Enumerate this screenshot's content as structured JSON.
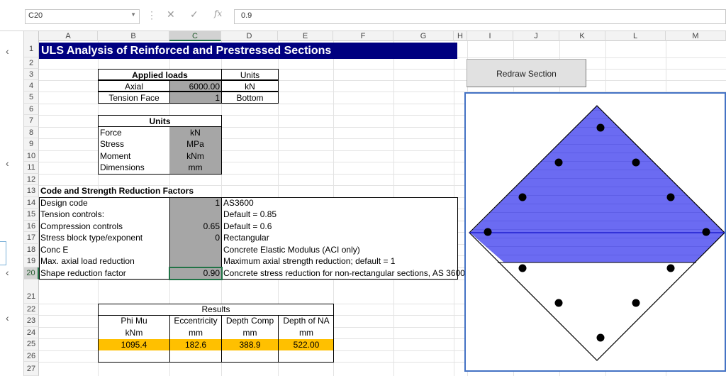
{
  "formula_bar": {
    "name_box": "C20",
    "formula_value": "0.9",
    "fx_label": "fx",
    "cancel_glyph": "✕",
    "enter_glyph": "✓"
  },
  "columns": [
    "A",
    "B",
    "C",
    "D",
    "E",
    "F",
    "G",
    "H",
    "I",
    "J",
    "K",
    "L",
    "M"
  ],
  "rows": [
    "1",
    "2",
    "3",
    "4",
    "5",
    "6",
    "7",
    "8",
    "9",
    "10",
    "11",
    "12",
    "13",
    "14",
    "15",
    "16",
    "17",
    "18",
    "19",
    "20",
    "21",
    "22",
    "23",
    "24",
    "25",
    "26",
    "27"
  ],
  "title": "ULS Analysis of Reinforced and Prestressed Sections",
  "applied_loads": {
    "header": "Applied loads",
    "units_header": "Units",
    "axial_label": "Axial",
    "axial_value": "6000.00",
    "axial_unit": "kN",
    "tension_label": "Tension Face",
    "tension_value": "1",
    "tension_unit": "Bottom"
  },
  "units_table": {
    "header": "Units",
    "rows": [
      {
        "label": "Force",
        "value": "kN"
      },
      {
        "label": "Stress",
        "value": "MPa"
      },
      {
        "label": "Moment",
        "value": "kNm"
      },
      {
        "label": "Dimensions",
        "value": "mm"
      }
    ]
  },
  "code_factors": {
    "header": "Code and Strength Reduction Factors",
    "rows": [
      {
        "label": "Design code",
        "value": "1",
        "note": "AS3600"
      },
      {
        "label": "Tension controls:",
        "value": "",
        "note": "Default = 0.85"
      },
      {
        "label": "Compression controls",
        "value": "0.65",
        "note": "Default = 0.6"
      },
      {
        "label": "Stress block type/exponent",
        "value": "0",
        "note": "Rectangular"
      },
      {
        "label": "Conc E",
        "value": "",
        "note": "Concrete Elastic Modulus (ACI only)"
      },
      {
        "label": "Max. axial load reduction",
        "value": "",
        "note": "Maximum axial strength reduction; default = 1"
      },
      {
        "label": "Shape reduction factor",
        "value": "0.90",
        "note": "Concrete stress reduction for non-rectangular sections, AS 3600"
      }
    ]
  },
  "results": {
    "header": "Results",
    "columns": [
      {
        "name": "Phi Mu",
        "unit": "kNm",
        "value": "1095.4"
      },
      {
        "name": "Eccentricity",
        "unit": "mm",
        "value": "182.6"
      },
      {
        "name": "Depth Comp",
        "unit": "mm",
        "value": "388.9"
      },
      {
        "name": "Depth of NA",
        "unit": "mm",
        "value": "522.00"
      }
    ]
  },
  "redraw_button": "Redraw Section",
  "colors": {
    "title_bg": "#000080",
    "compression_fill": "#6b6bf2",
    "input_gray": "#a6a6a6",
    "result_yellow": "#ffc000",
    "chart_border": "#4472c4",
    "selection_green": "#217346"
  },
  "left_pane_glyphs": [
    "‹",
    "‹",
    "‹",
    "‹"
  ]
}
